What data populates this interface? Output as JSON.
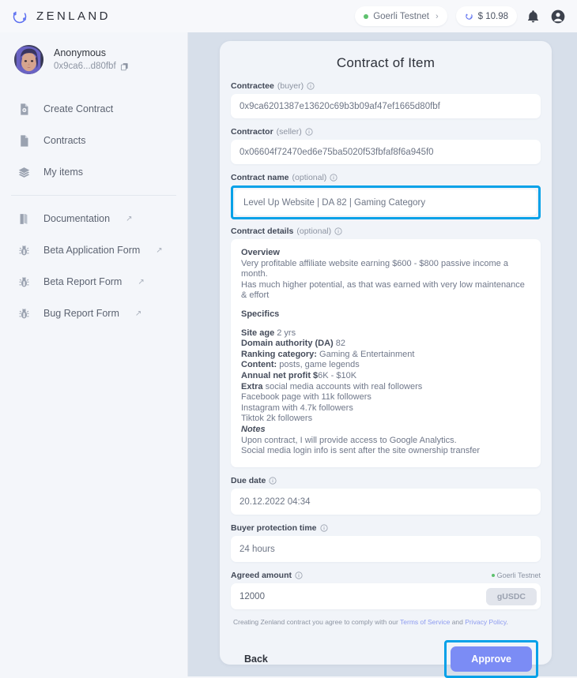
{
  "topbar": {
    "brand": "ZENLAND",
    "logo_icon": "zenland-orbit-logo",
    "network": {
      "label": "Goerli Testnet",
      "chevron": "›",
      "status_color": "#5ec16e"
    },
    "balance": {
      "value": "$ 10.98",
      "icon": "zen-token-icon"
    },
    "notifications_icon": "bell-icon",
    "account_icon": "account-circle-icon"
  },
  "sidebar": {
    "profile": {
      "name": "Anonymous",
      "address": "0x9ca6...d80fbf",
      "copy_icon": "copy-icon",
      "avatar_icon": "user-avatar"
    },
    "items": [
      {
        "label": "Create Contract",
        "icon": "file-add-icon",
        "external": ""
      },
      {
        "label": "Contracts",
        "icon": "file-icon",
        "external": ""
      },
      {
        "label": "My items",
        "icon": "layers-icon",
        "external": ""
      }
    ],
    "external_items": [
      {
        "label": "Documentation",
        "icon": "book-icon",
        "external": "↗"
      },
      {
        "label": "Beta Application Form",
        "icon": "bug-icon",
        "external": "↗"
      },
      {
        "label": "Beta Report Form",
        "icon": "bug-icon",
        "external": "↗"
      },
      {
        "label": "Bug Report Form",
        "icon": "bug-icon",
        "external": "↗"
      }
    ]
  },
  "card": {
    "title": "Contract of Item",
    "fields": {
      "contractee": {
        "label": "Contractee",
        "sub": "(buyer)",
        "value": "0x9ca6201387e13620c69b3b09af47ef1665d80fbf"
      },
      "contractor": {
        "label": "Contractor",
        "sub": "(seller)",
        "value": "0x06604f72470ed6e75ba5020f53fbfaf8f6a945f0"
      },
      "contract_name": {
        "label": "Contract name",
        "sub": "(optional)",
        "value": "Level Up Website | DA 82 | Gaming Category",
        "highlighted": true
      },
      "contract_details": {
        "label": "Contract details",
        "sub": "(optional)",
        "blocks": [
          {
            "type": "heading",
            "text": "Overview"
          },
          {
            "type": "text",
            "text": "Very profitable affiliate website earning $600 - $800 passive income a month."
          },
          {
            "type": "text",
            "text": "Has much higher potential, as that was earned with very low maintenance & effort"
          },
          {
            "type": "spacer"
          },
          {
            "type": "heading",
            "text": "Specifics"
          },
          {
            "type": "spacer"
          },
          {
            "type": "kv",
            "key": "Site age",
            "val": "2 yrs"
          },
          {
            "type": "kv",
            "key": "Domain authority (DA)",
            "val": "82"
          },
          {
            "type": "kv",
            "key": "Ranking category:",
            "val": "Gaming & Entertainment"
          },
          {
            "type": "kv",
            "key": "Content:",
            "val": "posts, game legends"
          },
          {
            "type": "kv",
            "key": "Annual net profit $",
            "val": "6K - $10K"
          },
          {
            "type": "kv",
            "key": "Extra",
            "val": "social media accounts with real followers"
          },
          {
            "type": "text",
            "text": "Facebook page with 11k followers"
          },
          {
            "type": "text",
            "text": "Instagram with 4.7k followers"
          },
          {
            "type": "text",
            "text": "Tiktok 2k followers"
          },
          {
            "type": "italic-heading",
            "text": "Notes"
          },
          {
            "type": "text",
            "text": "Upon contract, I will provide access to Google Analytics."
          },
          {
            "type": "text",
            "text": "Social media login info is sent after the site ownership transfer"
          }
        ]
      },
      "due_date": {
        "label": "Due date",
        "sub": "",
        "value": "20.12.2022 04:34"
      },
      "buyer_protection": {
        "label": "Buyer protection time",
        "sub": "",
        "value": "24 hours"
      },
      "agreed_amount": {
        "label": "Agreed amount",
        "sub": "",
        "value": "12000",
        "token": "gUSDC",
        "network_tag": "Goerli Testnet"
      }
    },
    "legal": {
      "prefix": "Creating Zenland contract you agree to comply with our ",
      "terms": "Terms of Service",
      "middle": " and ",
      "privacy": "Privacy Policy",
      "suffix": "."
    },
    "actions": {
      "back": "Back",
      "approve": "Approve",
      "approve_highlighted": true
    }
  },
  "colors": {
    "accent_highlight": "#05a1e8",
    "approve_button": "#7b8cf5",
    "network_dot": "#5ec16e",
    "link": "#8d9bf0"
  }
}
